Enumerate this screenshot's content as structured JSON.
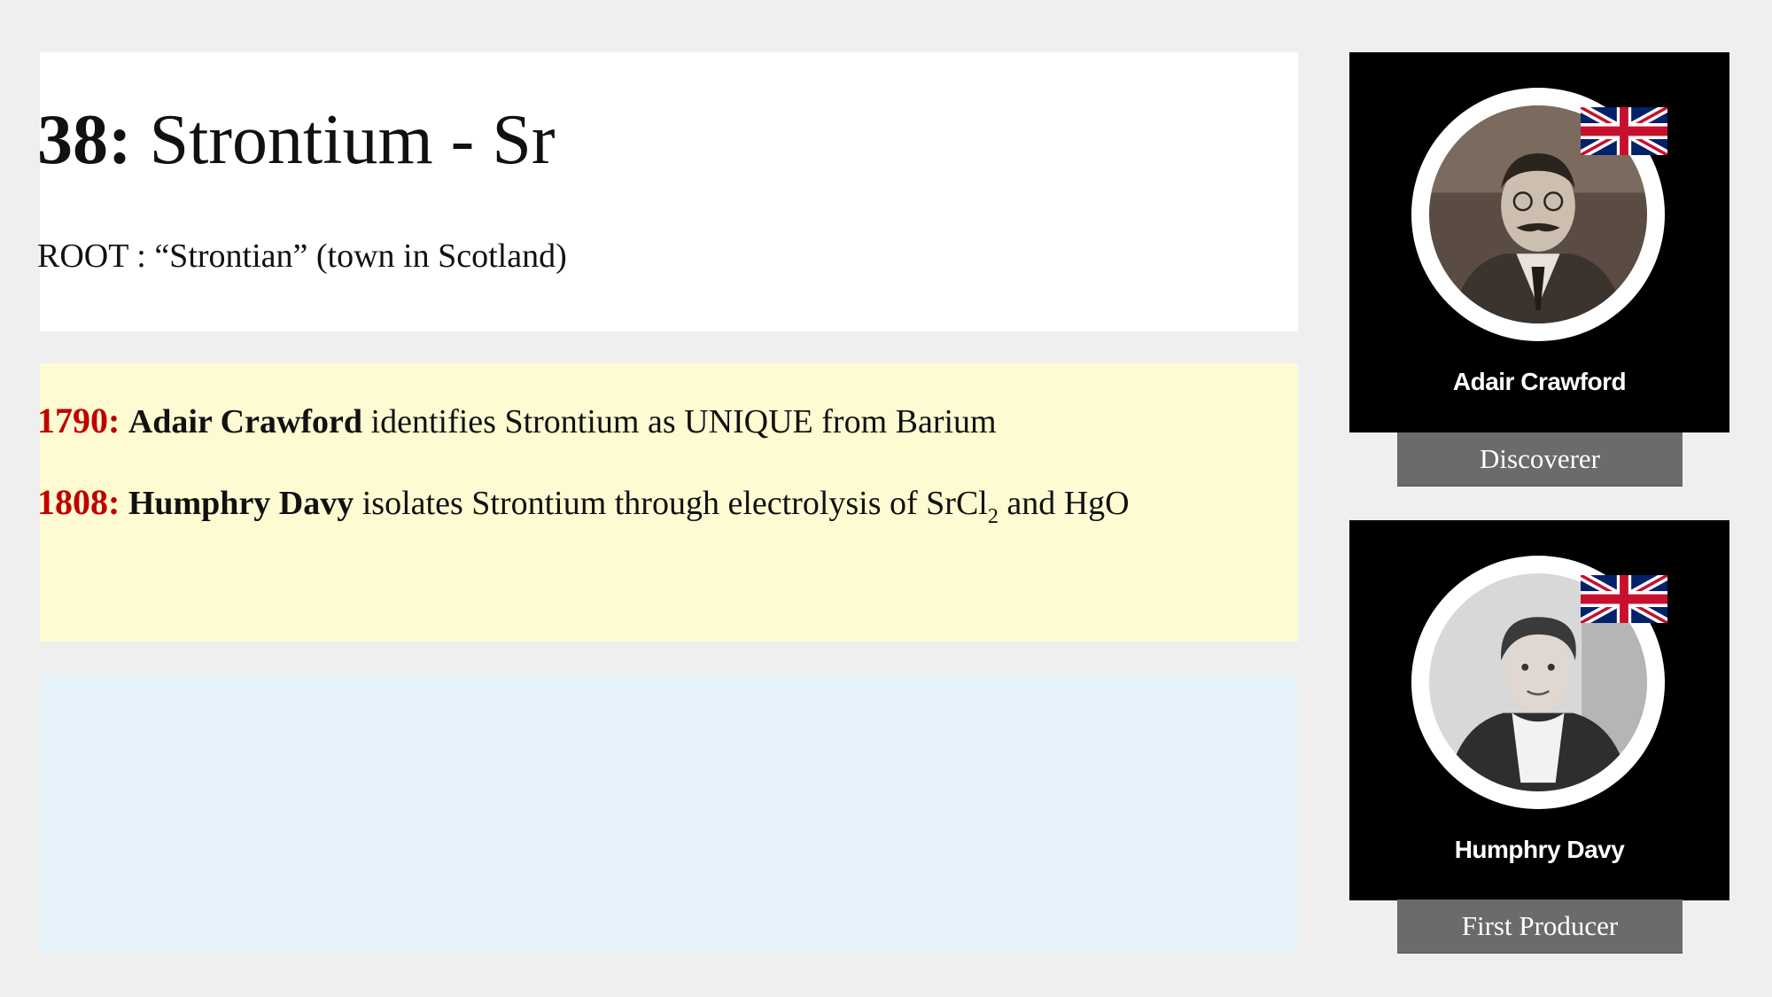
{
  "element": {
    "number_prefix": "38:",
    "name_symbol": "Strontium - Sr",
    "root": "ROOT : “Strontian” (town in Scotland)"
  },
  "events": [
    {
      "year": "1790:",
      "person": "Adair Crawford",
      "text": "identifies Strontium as UNIQUE from Barium"
    },
    {
      "year": "1808:",
      "person": "Humphry Davy",
      "text_before": "isolates Strontium through electrolysis of SrCl",
      "subscript": "2",
      "text_after": "and HgO"
    }
  ],
  "people": [
    {
      "name": "Adair Crawford",
      "role": "Discoverer",
      "flag_icon": "uk-flag-icon"
    },
    {
      "name": "Humphry Davy",
      "role": "First Producer",
      "flag_icon": "uk-flag-icon"
    }
  ],
  "colors": {
    "year_red": "#c00000",
    "events_bg": "#fefbd3",
    "notes_bg": "#e6f3fb",
    "role_bg": "#6b6b6b"
  }
}
